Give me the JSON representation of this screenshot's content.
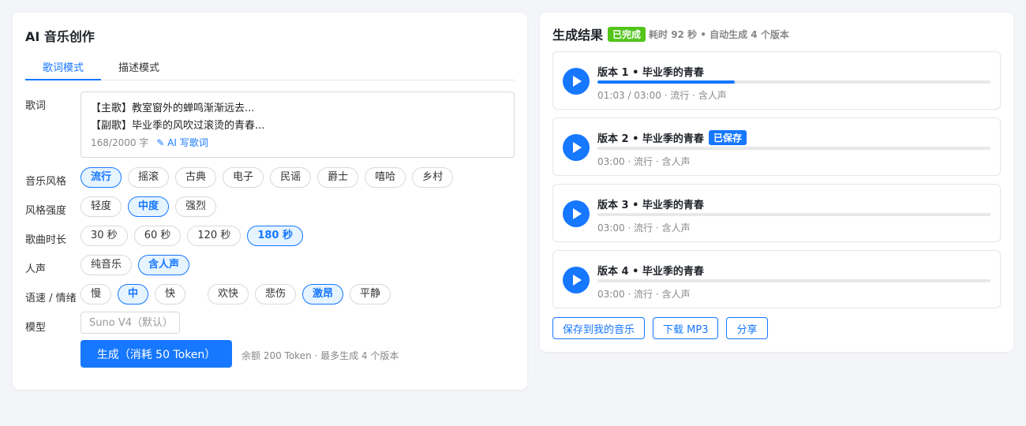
{
  "left": {
    "title": "AI 音乐创作",
    "tabs": [
      {
        "label": "歌词模式",
        "active": true
      },
      {
        "label": "描述模式",
        "active": false
      }
    ],
    "lyrics": {
      "label": "歌词",
      "lines": [
        "【主歌】教室窗外的蝉鸣渐渐远去...",
        "【副歌】毕业季的风吹过滚烫的青春..."
      ],
      "count": "168/2000 字",
      "ai_write": "✎ AI 写歌词"
    },
    "style": {
      "label": "音乐风格",
      "options": [
        "流行",
        "摇滚",
        "古典",
        "电子",
        "民谣",
        "爵士",
        "嘻哈",
        "乡村"
      ],
      "selected": 0
    },
    "intensity": {
      "label": "风格强度",
      "options": [
        "轻度",
        "中度",
        "强烈"
      ],
      "selected": 1
    },
    "duration": {
      "label": "歌曲时长",
      "options": [
        "30 秒",
        "60 秒",
        "120 秒",
        "180 秒"
      ],
      "selected": 3
    },
    "vocal": {
      "label": "人声",
      "options": [
        "纯音乐",
        "含人声"
      ],
      "selected": 1
    },
    "tempo_mood": {
      "label": "语速 / 情绪",
      "tempo": [
        "慢",
        "中",
        "快"
      ],
      "tempo_selected": 1,
      "mood": [
        "欢快",
        "悲伤",
        "激昂",
        "平静"
      ],
      "mood_selected": 2
    },
    "model": {
      "label": "模型",
      "placeholder": "Suno V4（默认）"
    },
    "generate": {
      "label": "生成（消耗 50 Token）",
      "note": "余额 200 Token · 最多生成 4 个版本"
    }
  },
  "right": {
    "title": "生成结果",
    "status": "已完成",
    "subtitle": "耗时 92 秒 • 自动生成 4 个版本",
    "versions": [
      {
        "title": "版本 1 • 毕业季的青春",
        "badge": "",
        "meta": "01:03 / 03:00 · 流行 · 含人声",
        "progress": 0.35
      },
      {
        "title": "版本 2 • 毕业季的青春",
        "badge": "已保存",
        "meta": "03:00 · 流行 · 含人声",
        "progress": 0
      },
      {
        "title": "版本 3 • 毕业季的青春",
        "badge": "",
        "meta": "03:00 · 流行 · 含人声",
        "progress": 0
      },
      {
        "title": "版本 4 • 毕业季的青春",
        "badge": "",
        "meta": "03:00 · 流行 · 含人声",
        "progress": 0
      }
    ],
    "actions": [
      "保存到我的音乐",
      "下载 MP3",
      "分享"
    ]
  },
  "colors": {
    "accent": "#1677ff",
    "success": "#52c41a",
    "background": "#f4f5f8"
  }
}
